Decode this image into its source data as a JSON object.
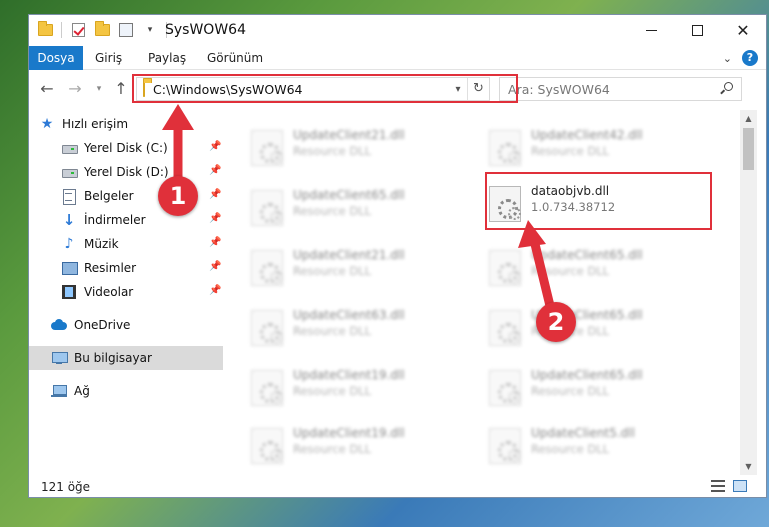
{
  "window": {
    "title": "SysWOW64",
    "min_label": "",
    "max_label": "",
    "close_label": "✕"
  },
  "ribbon": {
    "tabs": [
      "Dosya",
      "Giriş",
      "Paylaş",
      "Görünüm"
    ],
    "help_label": "?"
  },
  "navbar": {
    "address_path": "C:\\Windows\\SysWOW64",
    "search_placeholder": "Ara: SysWOW64"
  },
  "sidebar": {
    "items": [
      {
        "label": "Hızlı erişim",
        "icon": "star-icon",
        "pinned": false
      },
      {
        "label": "Yerel Disk (C:)",
        "icon": "disk-icon",
        "pinned": true
      },
      {
        "label": "Yerel Disk (D:)",
        "icon": "disk-icon",
        "pinned": true
      },
      {
        "label": "Belgeler",
        "icon": "documents-icon",
        "pinned": true
      },
      {
        "label": "İndirmeler",
        "icon": "download-icon",
        "pinned": true
      },
      {
        "label": "Müzik",
        "icon": "music-icon",
        "pinned": true
      },
      {
        "label": "Resimler",
        "icon": "pictures-icon",
        "pinned": true
      },
      {
        "label": "Videolar",
        "icon": "videos-icon",
        "pinned": true
      },
      {
        "label": "OneDrive",
        "icon": "onedrive-icon",
        "pinned": false
      },
      {
        "label": "Bu bilgisayar",
        "icon": "this-pc-icon",
        "pinned": false,
        "selected": true
      },
      {
        "label": "Ağ",
        "icon": "network-icon",
        "pinned": false
      }
    ]
  },
  "files": {
    "highlighted": {
      "name": "dataobjvb.dll",
      "version": "1.0.734.38712"
    },
    "blurred": [
      {
        "name": "UpdateClient21.dll",
        "type": "Resource DLL"
      },
      {
        "name": "UpdateClient42.dll",
        "type": "Resource DLL"
      },
      {
        "name": "UpdateClient65.dll",
        "type": "Resource DLL"
      },
      {
        "name": "UpdateClient21.dll",
        "type": "Resource DLL"
      },
      {
        "name": "UpdateClient65.dll",
        "type": "Resource DLL"
      },
      {
        "name": "UpdateClient63.dll",
        "type": "Resource DLL"
      },
      {
        "name": "UpdateClient65.dll",
        "type": "Resource DLL"
      },
      {
        "name": "UpdateClient19.dll",
        "type": "Resource DLL"
      },
      {
        "name": "UpdateClient65.dll",
        "type": "Resource DLL"
      },
      {
        "name": "UpdateClient19.dll",
        "type": "Resource DLL"
      },
      {
        "name": "UpdateClient5.dll",
        "type": "Resource DLL"
      }
    ]
  },
  "status": {
    "item_count": "121 öğe"
  },
  "annotations": {
    "badge_1": "1",
    "badge_2": "2",
    "color": "#e0303a"
  }
}
